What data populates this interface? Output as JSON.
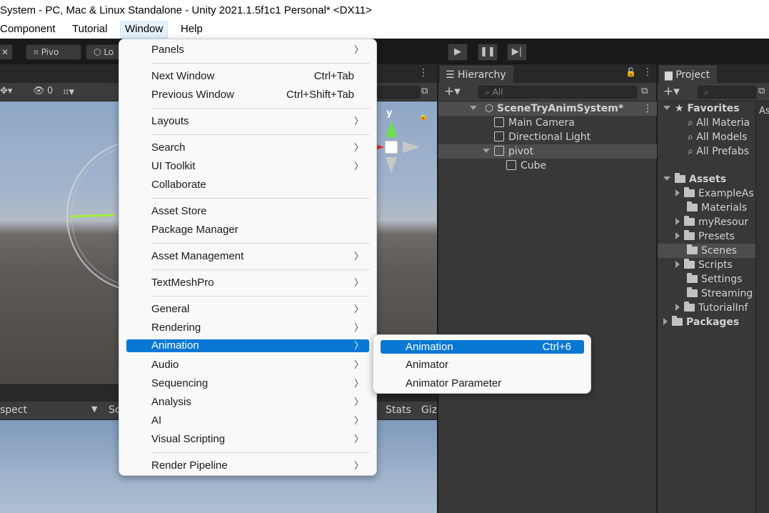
{
  "window_title": "System - PC, Mac & Linux Standalone - Unity 2021.1.5f1c1 Personal* <DX11>",
  "menubar": [
    "Component",
    "Tutorial",
    "Window",
    "Help"
  ],
  "toolbar": {
    "pivot_label": "Pivo",
    "local_label": "Lo"
  },
  "scene": {
    "toolbar_count": "0",
    "gizmo_y_label": "y",
    "game_tab_partial": "spect",
    "stats_label": "Stats",
    "gizmos_partial": "Giz",
    "display_partial": "Sc"
  },
  "hierarchy": {
    "tab": "Hierarchy",
    "search_placeholder": "All",
    "scene_name": "SceneTryAnimSystem*",
    "items": [
      "Main Camera",
      "Directional Light",
      "pivot",
      "Cube"
    ]
  },
  "project": {
    "tab": "Project",
    "favorites": "Favorites",
    "favorite_items": [
      "All Materia",
      "All Models",
      "All Prefabs"
    ],
    "assets": "Assets",
    "asset_items": [
      "ExampleAs",
      "Materials",
      "myResour",
      "Presets",
      "Scenes",
      "Scripts",
      "Settings",
      "Streaming",
      "TutorialInf"
    ],
    "packages": "Packages",
    "right_partial": "As"
  },
  "window_menu": {
    "items": [
      {
        "label": "Panels"
      },
      {
        "label": "Next Window",
        "shortcut": "Ctrl+Tab"
      },
      {
        "label": "Previous Window",
        "shortcut": "Ctrl+Shift+Tab"
      },
      {
        "label": "Layouts"
      },
      {
        "label": "Search"
      },
      {
        "label": "UI Toolkit"
      },
      {
        "label": "Collaborate"
      },
      {
        "label": "Asset Store"
      },
      {
        "label": "Package Manager"
      },
      {
        "label": "Asset Management"
      },
      {
        "label": "TextMeshPro"
      },
      {
        "label": "General"
      },
      {
        "label": "Rendering"
      },
      {
        "label": "Animation"
      },
      {
        "label": "Audio"
      },
      {
        "label": "Sequencing"
      },
      {
        "label": "Analysis"
      },
      {
        "label": "AI"
      },
      {
        "label": "Visual Scripting"
      },
      {
        "label": "Render Pipeline"
      }
    ]
  },
  "animation_submenu": [
    {
      "label": "Animation",
      "shortcut": "Ctrl+6"
    },
    {
      "label": "Animator"
    },
    {
      "label": "Animator Parameter"
    }
  ],
  "colors": {
    "highlight": "#0878d4",
    "editor_bg": "#383838",
    "menu_bg": "#f9f9f9"
  }
}
